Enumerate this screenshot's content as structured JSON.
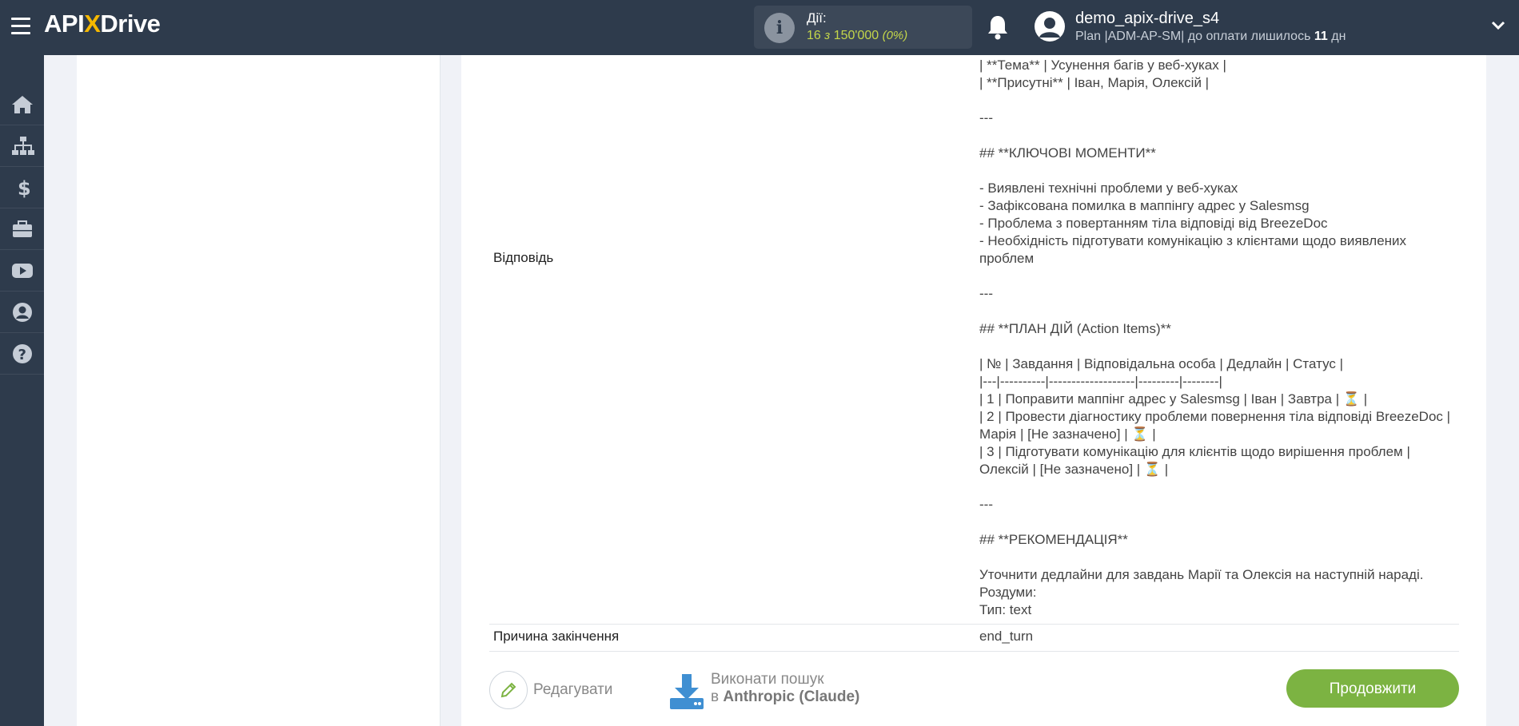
{
  "header": {
    "logo_api": "API",
    "logo_x": "X",
    "logo_drive": "Drive",
    "actions_label": "Дії:",
    "actions_count": "16",
    "actions_of": "з",
    "actions_limit": "150'000",
    "actions_percent": "(0%)",
    "user_name": "demo_apix-drive_s4",
    "user_plan_prefix": "Plan |ADM-AP-SM| до оплати лишилось",
    "user_plan_days": "11",
    "user_plan_suffix": "дн"
  },
  "sidebar": {
    "items": [
      {
        "icon": "home-icon"
      },
      {
        "icon": "sitemap-icon"
      },
      {
        "icon": "dollar-icon"
      },
      {
        "icon": "briefcase-icon"
      },
      {
        "icon": "youtube-icon"
      },
      {
        "icon": "user-circle-icon"
      },
      {
        "icon": "question-icon"
      }
    ]
  },
  "fields": {
    "response_label": "Відповідь",
    "response_value": "| **Тема** | Усунення багів у веб-хуках |\n| **Присутні** | Іван, Марія, Олексій |\n\n---\n\n## **КЛЮЧОВІ МОМЕНТИ**\n\n- Виявлені технічні проблеми у веб-хуках\n- Зафіксована помилка в маппінгу адрес у Salesmsg\n- Проблема з повертанням тіла відповіді від BreezeDoc\n- Необхідність підготувати комунікацію з клієнтами щодо виявлених проблем\n\n---\n\n## **ПЛАН ДІЙ (Action Items)**\n\n| № | Завдання | Відповідальна особа | Дедлайн | Статус |\n|---|----------|-------------------|---------|--------|\n| 1 | Поправити маппінг адрес у Salesmsg | Іван | Завтра | ⏳ |\n| 2 | Провести діагностику проблеми повернення тіла відповіді BreezeDoc | Марія | [Не зазначено] | ⏳ |\n| 3 | Підготувати комунікацію для клієнтів щодо вирішення проблем | Олексій | [Не зазначено] | ⏳ |\n\n---\n\n## **РЕКОМЕНДАЦІЯ**\n\nУточнити дедлайни для завдань Марії та Олексія на наступній нараді.\nРоздуми:\nТип: text",
    "finish_reason_label": "Причина закінчення",
    "finish_reason_value": "end_turn"
  },
  "buttons": {
    "edit_label": "Редагувати",
    "search_line1": "Виконати пошук",
    "search_line2_prefix": "в",
    "search_line2_service": "Anthropic (Claude)",
    "continue_label": "Продовжити"
  },
  "colors": {
    "topbar": "#2e3b4c",
    "accent_green": "#7cb342",
    "logo_x": "#f5b800",
    "count_green": "#c4d64a"
  }
}
